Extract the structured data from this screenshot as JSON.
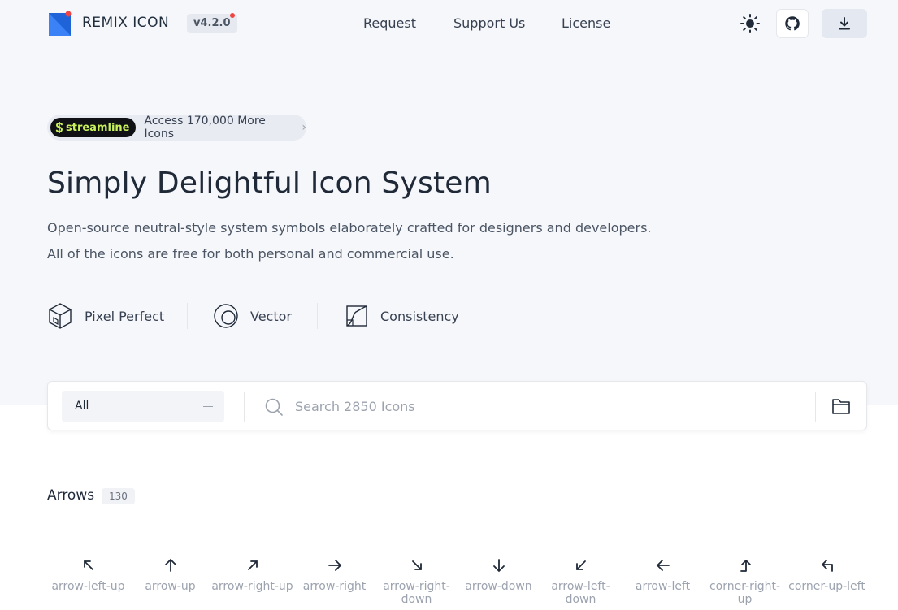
{
  "header": {
    "brand": "REMIX ICON",
    "version": "v4.2.0",
    "nav": [
      "Request",
      "Support Us",
      "License"
    ]
  },
  "promo": {
    "badge": "streamline",
    "text": "Access 170,000 More Icons",
    "chevron": "›"
  },
  "hero": {
    "headline": "Simply Delightful Icon System",
    "desc1": "Open-source neutral-style system symbols elaborately crafted for designers and developers.",
    "desc2": "All of the icons are free for both personal and commercial use."
  },
  "features": [
    {
      "label": "Pixel Perfect",
      "icon": "cube-icon"
    },
    {
      "label": "Vector",
      "icon": "vector-circle-icon"
    },
    {
      "label": "Consistency",
      "icon": "consistency-icon"
    }
  ],
  "search": {
    "category": "All",
    "placeholder": "Search 2850 Icons"
  },
  "section": {
    "title": "Arrows",
    "count": "130",
    "icons": [
      {
        "name": "arrow-left-up",
        "label1": "arrow-left-up",
        "label2": ""
      },
      {
        "name": "arrow-up",
        "label1": "arrow-up",
        "label2": ""
      },
      {
        "name": "arrow-right-up",
        "label1": "arrow-right-up",
        "label2": ""
      },
      {
        "name": "arrow-right",
        "label1": "arrow-right",
        "label2": ""
      },
      {
        "name": "arrow-right-down",
        "label1": "arrow-right-",
        "label2": "down"
      },
      {
        "name": "arrow-down",
        "label1": "arrow-down",
        "label2": ""
      },
      {
        "name": "arrow-left-down",
        "label1": "arrow-left-",
        "label2": "down"
      },
      {
        "name": "arrow-left",
        "label1": "arrow-left",
        "label2": ""
      },
      {
        "name": "corner-right-up",
        "label1": "corner-right-",
        "label2": "up"
      },
      {
        "name": "corner-up-left",
        "label1": "corner-up-left",
        "label2": ""
      }
    ]
  },
  "colors": {
    "accent": "#2563eb",
    "notice": "#ef4444",
    "streamline": "#c9f25b",
    "hero_bg": "#f6f7fb"
  }
}
